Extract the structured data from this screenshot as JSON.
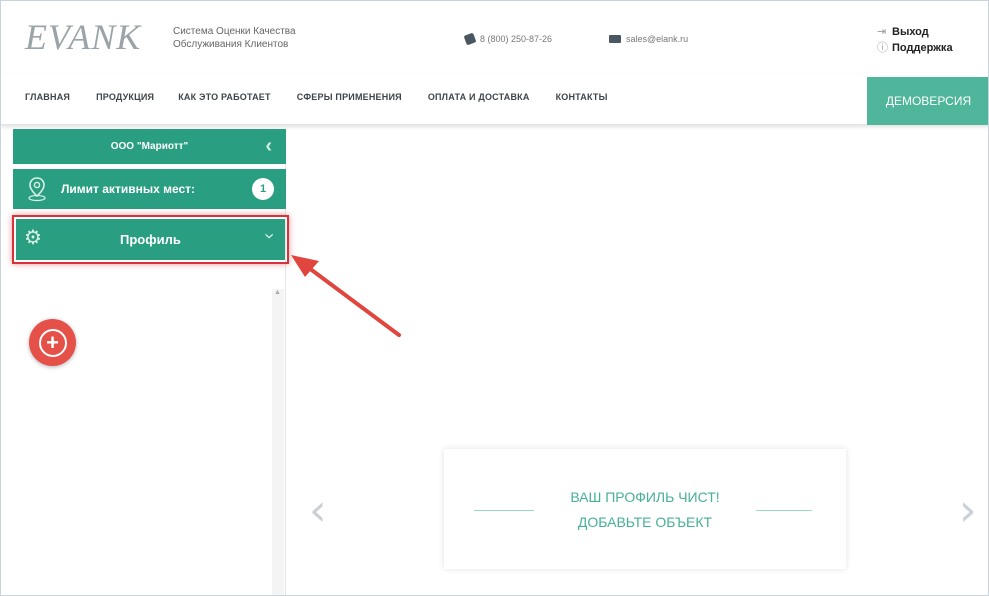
{
  "header": {
    "logo_text": "EVANK",
    "tagline_line1": "Система Оценки Качества",
    "tagline_line2": "Обслуживания Клиентов",
    "phone": "8 (800) 250-87-26",
    "email": "sales@elank.ru",
    "logout_label": "Выход",
    "support_label": "Поддержка",
    "icons": {
      "logout": "logout-icon",
      "support": "help-icon",
      "phone": "phone-icon",
      "email": "mail-icon"
    }
  },
  "nav": {
    "items": [
      {
        "label": "ГЛАВНАЯ"
      },
      {
        "label": "ПРОДУКЦИЯ"
      },
      {
        "label": "КАК ЭТО РАБОТАЕТ"
      },
      {
        "label": "СФЕРЫ ПРИМЕНЕНИЯ"
      },
      {
        "label": "ОПЛАТА И ДОСТАВКА"
      },
      {
        "label": "КОНТАКТЫ"
      }
    ],
    "demo_label": "ДЕМОВЕРСИЯ"
  },
  "sidebar": {
    "company": "ООО \"Мариотт\"",
    "limit_label": "Лимит активных мест:",
    "limit_count": "1",
    "profile_label": "Профиль"
  },
  "main": {
    "empty_line1": "ВАШ ПРОФИЛЬ ЧИСТ!",
    "empty_line2": "ДОБАВЬТЕ ОБЪЕКТ",
    "prev_glyph": "‹",
    "next_glyph": "›"
  },
  "colors": {
    "accent": "#2a9e80",
    "demo": "#4fb59b",
    "highlight": "#d8323a",
    "add_button": "#e55048",
    "empty_text": "#46b096"
  }
}
